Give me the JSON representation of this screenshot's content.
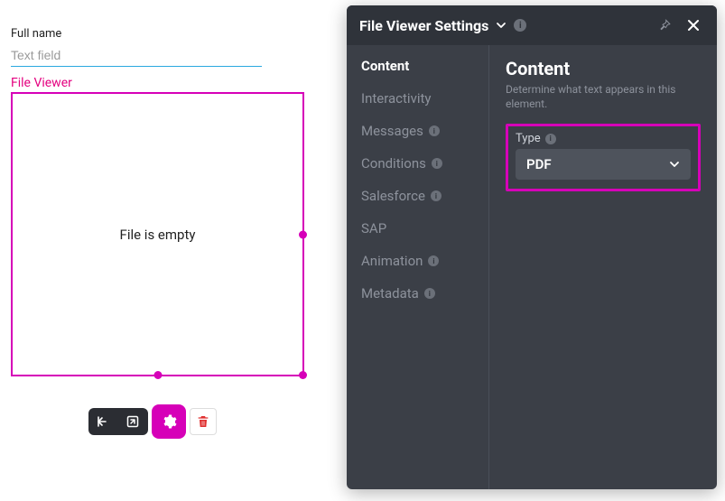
{
  "canvas": {
    "field_label": "Full name",
    "field_placeholder": "Text field",
    "file_viewer_label": "File Viewer",
    "file_viewer_empty": "File is empty"
  },
  "toolbar": {
    "collapse_icon": "collapse-in-icon",
    "open_icon": "open-external-icon",
    "gear_icon": "gear-icon",
    "trash_icon": "trash-icon"
  },
  "panel": {
    "title": "File Viewer Settings",
    "nav": [
      {
        "label": "Content",
        "active": true,
        "info": false
      },
      {
        "label": "Interactivity",
        "active": false,
        "info": false
      },
      {
        "label": "Messages",
        "active": false,
        "info": true
      },
      {
        "label": "Conditions",
        "active": false,
        "info": true
      },
      {
        "label": "Salesforce",
        "active": false,
        "info": true
      },
      {
        "label": "SAP",
        "active": false,
        "info": false
      },
      {
        "label": "Animation",
        "active": false,
        "info": true
      },
      {
        "label": "Metadata",
        "active": false,
        "info": true
      }
    ],
    "content": {
      "heading": "Content",
      "description": "Determine what text appears in this element.",
      "type_label": "Type",
      "type_value": "PDF"
    }
  }
}
